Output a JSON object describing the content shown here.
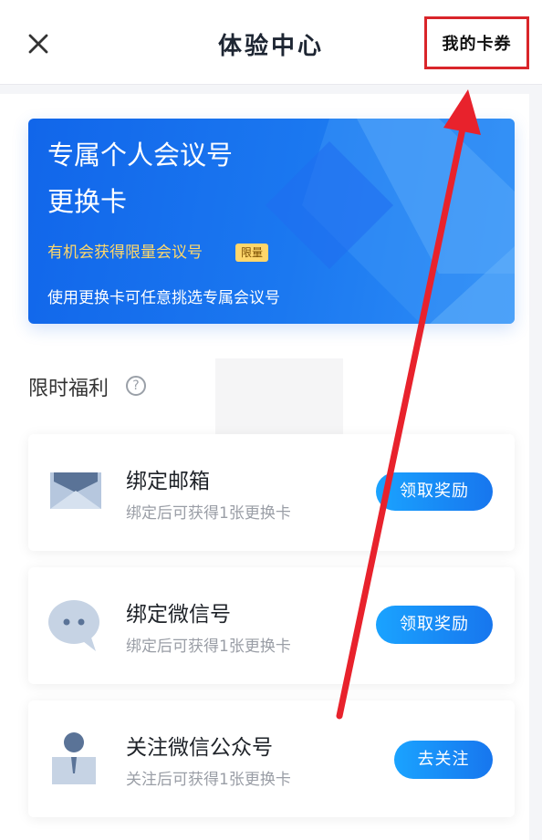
{
  "header": {
    "title": "体验中心",
    "my_cards": "我的卡券",
    "close_icon": "close-icon"
  },
  "banner": {
    "title_line1": "专属个人会议号",
    "title_line2": "更换卡",
    "highlight": "有机会获得限量会议号",
    "tag": "限量",
    "description": "使用更换卡可任意挑选专属会议号"
  },
  "section": {
    "title": "限时福利",
    "help_icon": "question-circle-icon"
  },
  "tasks": [
    {
      "icon": "envelope-icon",
      "title": "绑定邮箱",
      "desc": "绑定后可获得1张更换卡",
      "button": "领取奖励"
    },
    {
      "icon": "chat-bubble-icon",
      "title": "绑定微信号",
      "desc": "绑定后可获得1张更换卡",
      "button": "领取奖励"
    },
    {
      "icon": "person-icon",
      "title": "关注微信公众号",
      "desc": "关注后可获得1张更换卡",
      "button": "去关注"
    }
  ],
  "colors": {
    "accent_blue": "#1776ee",
    "highlight_yellow": "#ffd86a",
    "annotation_red": "#d9252a"
  }
}
